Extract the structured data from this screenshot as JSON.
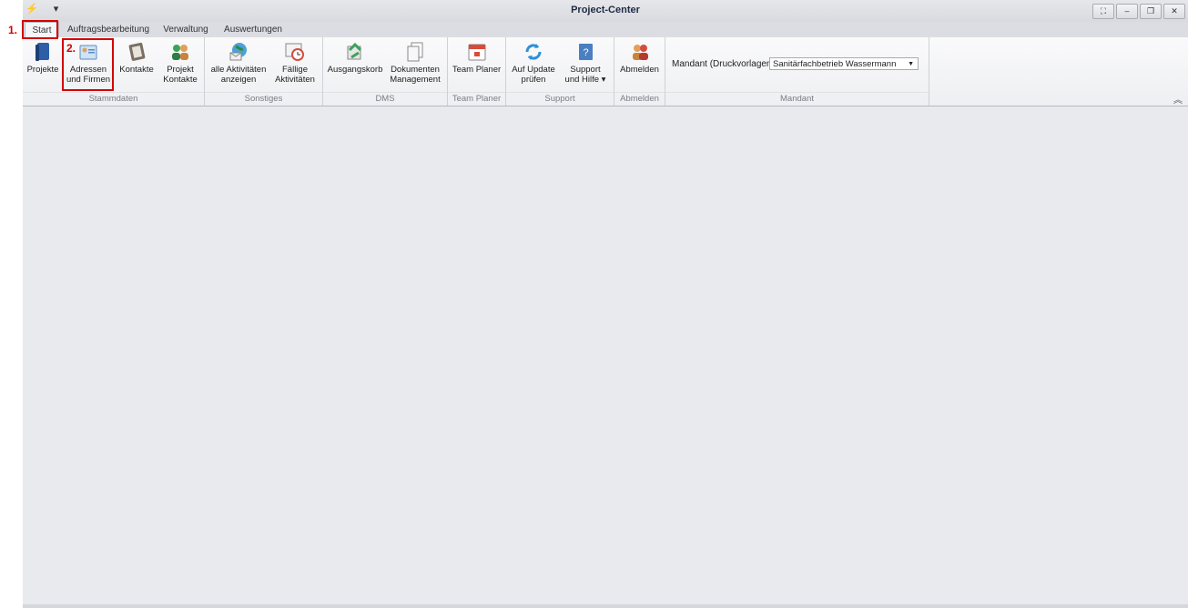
{
  "window": {
    "title": "Project-Center"
  },
  "tabs": [
    "Start",
    "Auftragsbearbeitung",
    "Verwaltung",
    "Auswertungen"
  ],
  "ribbon": {
    "stammdaten": {
      "label": "Stammdaten",
      "buttons": {
        "projekte": [
          "Projekte"
        ],
        "adressen": [
          "Adressen",
          "und Firmen"
        ],
        "kontakte": [
          "Kontakte"
        ],
        "projekt_kontakte": [
          "Projekt",
          "Kontakte"
        ]
      }
    },
    "sonstiges": {
      "label": "Sonstiges",
      "buttons": {
        "alle": [
          "alle Aktivitäten",
          "anzeigen"
        ],
        "faellige": [
          "Fällige",
          "Aktivitäten"
        ]
      }
    },
    "dms": {
      "label": "DMS",
      "buttons": {
        "ausgang": [
          "Ausgangskorb"
        ],
        "dokumenten": [
          "Dokumenten",
          "Management"
        ]
      }
    },
    "team": {
      "label": "Team Planer",
      "buttons": {
        "team": [
          "Team Planer"
        ]
      }
    },
    "support": {
      "label": "Support",
      "buttons": {
        "update": [
          "Auf Update",
          "prüfen"
        ],
        "hilfe": [
          "Support",
          "und Hilfe ▾"
        ]
      }
    },
    "abmelden": {
      "label": "Abmelden",
      "buttons": {
        "abmelden": [
          "Abmelden"
        ]
      }
    },
    "mandant": {
      "label": "Mandant",
      "field_label": "Mandant (Druckvorlagen):",
      "selected": "Sanitärfachbetrieb Wassermann"
    }
  },
  "annotations": {
    "step1": "1.",
    "step2": "2."
  }
}
